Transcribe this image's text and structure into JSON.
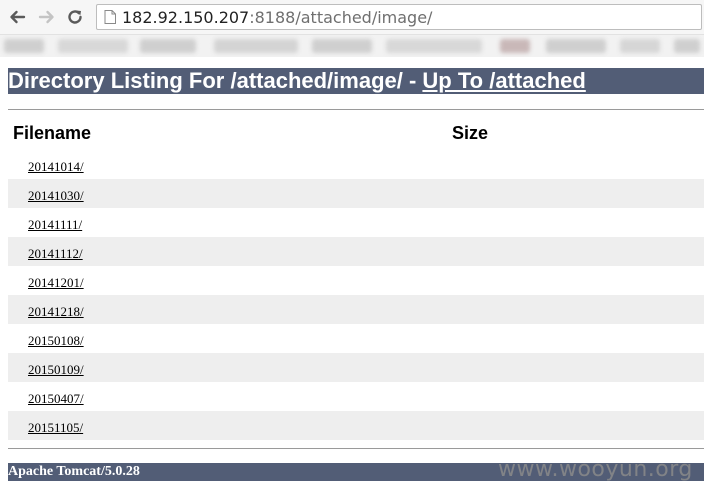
{
  "browser": {
    "url_host": "182.92.150.207",
    "url_rest": ":8188/attached/image/"
  },
  "listing": {
    "title_prefix": "Directory Listing For /attached/image/ - ",
    "up_link": "Up To /attached",
    "col_filename": "Filename",
    "col_size": "Size",
    "entries": [
      "20141014/",
      "20141030/",
      "20141111/",
      "20141112/",
      "20141201/",
      "20141218/",
      "20150108/",
      "20150109/",
      "20150407/",
      "20151105/"
    ]
  },
  "footer": {
    "server": "Apache Tomcat/5.0.28"
  },
  "watermark": "www.wooyun.org",
  "colors": {
    "header_bg": "#525d76",
    "row_alt_bg": "#eeeeee"
  },
  "icons": [
    "back-arrow-icon",
    "forward-arrow-icon",
    "reload-icon",
    "page-icon"
  ]
}
